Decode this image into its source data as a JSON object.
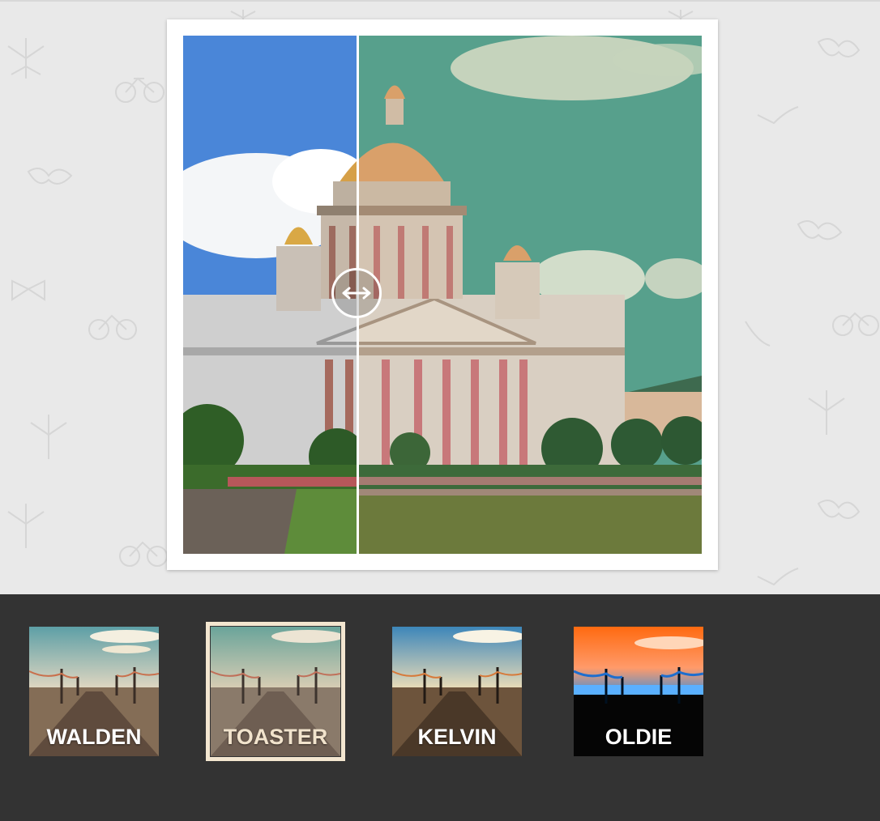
{
  "editor": {
    "split_position": 0.34
  },
  "filters": [
    {
      "id": "walden",
      "label": "WALDEN",
      "selected": false
    },
    {
      "id": "toaster",
      "label": "TOASTER",
      "selected": true
    },
    {
      "id": "kelvin",
      "label": "KELVIN",
      "selected": false
    },
    {
      "id": "oldie",
      "label": "OLDIE",
      "selected": false
    }
  ],
  "colors": {
    "background": "#e9e9e9",
    "bottom_bar": "#333333",
    "selected_outline": "#f3e6d0",
    "sky_original": "#4a86d8",
    "sky_filtered": "#57a08c"
  },
  "icons": {
    "handle": "left-right-arrow-icon",
    "pattern": [
      "leaf-icon",
      "bicycle-icon",
      "mustache-icon",
      "pipe-icon",
      "bowtie-icon"
    ]
  }
}
